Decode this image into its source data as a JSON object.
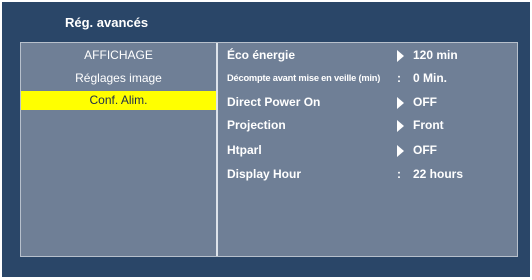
{
  "window": {
    "title": "Rég. avancés"
  },
  "menu": {
    "items": [
      {
        "label": "AFFICHAGE"
      },
      {
        "label": "Réglages image"
      },
      {
        "label": "Conf. Alim."
      }
    ],
    "selected_index": 2
  },
  "settings": [
    {
      "label": "Éco énergie",
      "marker": "arrow-icon",
      "value": "120 min"
    },
    {
      "label": "Décompte avant mise en veille (min)",
      "marker": ":",
      "value": "0 Min."
    },
    {
      "label": "Direct Power On",
      "marker": "arrow-icon",
      "value": "OFF"
    },
    {
      "label": "Projection",
      "marker": "arrow-icon",
      "value": "Front"
    },
    {
      "label": "Htparl",
      "marker": "arrow-icon",
      "value": "OFF"
    },
    {
      "label": "Display Hour",
      "marker": ":",
      "value": "22 hours"
    }
  ],
  "colors": {
    "background": "#2a4668",
    "panel": "#6f7f96",
    "highlight": "#ffff00",
    "text": "#ffffff"
  }
}
